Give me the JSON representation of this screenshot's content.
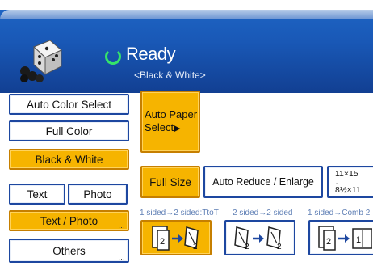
{
  "header": {
    "status": "Ready",
    "mode": "<Black & White>",
    "colors": {
      "bar_top": "#1f67c7",
      "bar_bottom": "#123f92",
      "ready_ring": "#35e46a"
    },
    "logo_icon": "dice-logo-icon"
  },
  "color_modes": {
    "auto_color_select": "Auto Color Select",
    "full_color": "Full Color",
    "black_white": "Black & White"
  },
  "original_type": {
    "text": "Text",
    "photo": "Photo",
    "text_photo": "Text / Photo",
    "others": "Others"
  },
  "paper": {
    "auto_paper_line1": "Auto Paper",
    "auto_paper_line2": "Select",
    "arrow_glyph": "▶"
  },
  "size": {
    "full_size": "Full Size",
    "auto_reduce_enlarge": "Auto Reduce / Enlarge",
    "ratio_top": "11×15",
    "ratio_arrow": "↓",
    "ratio_bottom": "8½×11"
  },
  "duplex": {
    "option1_label": "1 sided→2 sided:TtoT",
    "option2_label": "2 sided→2 sided",
    "option3_label": "1 sided→Comb 2"
  },
  "colors": {
    "selected_orange": "#f6b400",
    "button_border_blue": "#1d47a0"
  }
}
